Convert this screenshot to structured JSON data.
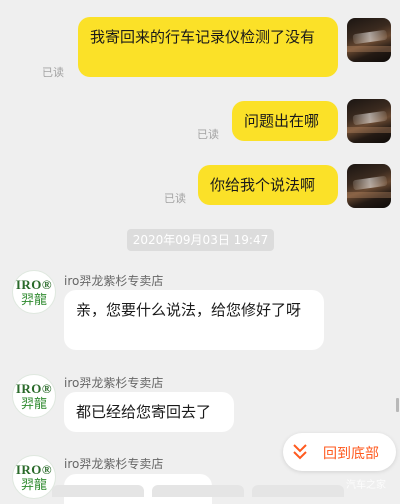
{
  "messages_me": [
    {
      "text": "我寄回来的行车记录仪检测了没有",
      "read": "已读"
    },
    {
      "text": "问题出在哪",
      "read": "已读"
    },
    {
      "text": "你给我个说法啊",
      "read": "已读"
    }
  ],
  "timestamp": "2020年09月03日 19:47",
  "shop": {
    "name": "iro羿龙紫杉专卖店",
    "avatar_line1": "IRO®",
    "avatar_line2": "羿龍"
  },
  "messages_shop": [
    {
      "text": "亲，您要什么说法，给您修好了呀"
    },
    {
      "text": "都已经给您寄回去了"
    }
  ],
  "back_to_bottom": {
    "icon": "double-chevron-down-icon",
    "label": "回到底部"
  },
  "watermark": "汽车之家",
  "colors": {
    "my_bubble": "#fbe128",
    "accent": "#ff5a1f",
    "background": "#efefef"
  }
}
